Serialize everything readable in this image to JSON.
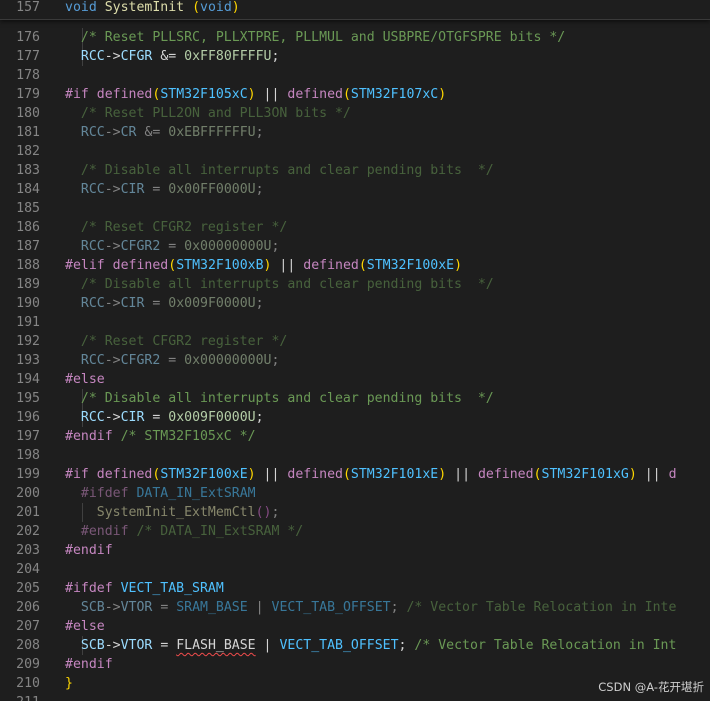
{
  "editor": {
    "sticky": {
      "line_number": "157",
      "tokens": [
        [
          "kw",
          "void"
        ],
        [
          "op",
          " "
        ],
        [
          "fn",
          "SystemInit"
        ],
        [
          "op",
          " "
        ],
        [
          "br1",
          "("
        ],
        [
          "kw",
          "void"
        ],
        [
          "br1",
          ")"
        ]
      ]
    },
    "lines": [
      {
        "n": "176",
        "g": [
          18
        ],
        "t": [
          [
            "op",
            "  "
          ],
          [
            "cm",
            "/* Reset PLLSRC, PLLXTPRE, PLLMUL and USBPRE/OTGFSPRE bits */"
          ]
        ]
      },
      {
        "n": "177",
        "g": [
          18
        ],
        "t": [
          [
            "op",
            "  "
          ],
          [
            "var",
            "RCC"
          ],
          [
            "op",
            "->"
          ],
          [
            "var",
            "CFGR"
          ],
          [
            "op",
            " &= "
          ],
          [
            "num",
            "0xFF80FFFFU"
          ],
          [
            "op",
            ";"
          ]
        ]
      },
      {
        "n": "178",
        "t": []
      },
      {
        "n": "179",
        "t": [
          [
            "pp",
            "#if"
          ],
          [
            "op",
            " "
          ],
          [
            "pp",
            "defined"
          ],
          [
            "br1",
            "("
          ],
          [
            "mac",
            "STM32F105xC"
          ],
          [
            "br1",
            ")"
          ],
          [
            "op",
            " || "
          ],
          [
            "pp",
            "defined"
          ],
          [
            "br1",
            "("
          ],
          [
            "mac",
            "STM32F107xC"
          ],
          [
            "br1",
            ")"
          ]
        ]
      },
      {
        "n": "180",
        "dim": true,
        "t": [
          [
            "op",
            "  "
          ],
          [
            "cm",
            "/* Reset PLL2ON and PLL3ON bits */"
          ]
        ]
      },
      {
        "n": "181",
        "dim": true,
        "t": [
          [
            "op",
            "  "
          ],
          [
            "var",
            "RCC"
          ],
          [
            "op",
            "->"
          ],
          [
            "var",
            "CR"
          ],
          [
            "op",
            " &= "
          ],
          [
            "num",
            "0xEBFFFFFFU"
          ],
          [
            "op",
            ";"
          ]
        ]
      },
      {
        "n": "182",
        "t": []
      },
      {
        "n": "183",
        "dim": true,
        "t": [
          [
            "op",
            "  "
          ],
          [
            "cm",
            "/* Disable all interrupts and clear pending bits  */"
          ]
        ]
      },
      {
        "n": "184",
        "dim": true,
        "t": [
          [
            "op",
            "  "
          ],
          [
            "var",
            "RCC"
          ],
          [
            "op",
            "->"
          ],
          [
            "var",
            "CIR"
          ],
          [
            "op",
            " = "
          ],
          [
            "num",
            "0x00FF0000U"
          ],
          [
            "op",
            ";"
          ]
        ]
      },
      {
        "n": "185",
        "t": []
      },
      {
        "n": "186",
        "dim": true,
        "t": [
          [
            "op",
            "  "
          ],
          [
            "cm",
            "/* Reset CFGR2 register */"
          ]
        ]
      },
      {
        "n": "187",
        "dim": true,
        "t": [
          [
            "op",
            "  "
          ],
          [
            "var",
            "RCC"
          ],
          [
            "op",
            "->"
          ],
          [
            "var",
            "CFGR2"
          ],
          [
            "op",
            " = "
          ],
          [
            "num",
            "0x00000000U"
          ],
          [
            "op",
            ";"
          ]
        ]
      },
      {
        "n": "188",
        "t": [
          [
            "pp",
            "#elif"
          ],
          [
            "op",
            " "
          ],
          [
            "pp",
            "defined"
          ],
          [
            "br1",
            "("
          ],
          [
            "mac",
            "STM32F100xB"
          ],
          [
            "br1",
            ")"
          ],
          [
            "op",
            " || "
          ],
          [
            "pp",
            "defined"
          ],
          [
            "br1",
            "("
          ],
          [
            "mac",
            "STM32F100xE"
          ],
          [
            "br1",
            ")"
          ]
        ]
      },
      {
        "n": "189",
        "dim": true,
        "t": [
          [
            "op",
            "  "
          ],
          [
            "cm",
            "/* Disable all interrupts and clear pending bits  */"
          ]
        ]
      },
      {
        "n": "190",
        "dim": true,
        "t": [
          [
            "op",
            "  "
          ],
          [
            "var",
            "RCC"
          ],
          [
            "op",
            "->"
          ],
          [
            "var",
            "CIR"
          ],
          [
            "op",
            " = "
          ],
          [
            "num",
            "0x009F0000U"
          ],
          [
            "op",
            ";"
          ]
        ]
      },
      {
        "n": "191",
        "t": []
      },
      {
        "n": "192",
        "dim": true,
        "t": [
          [
            "op",
            "  "
          ],
          [
            "cm",
            "/* Reset CFGR2 register */"
          ]
        ]
      },
      {
        "n": "193",
        "dim": true,
        "t": [
          [
            "op",
            "  "
          ],
          [
            "var",
            "RCC"
          ],
          [
            "op",
            "->"
          ],
          [
            "var",
            "CFGR2"
          ],
          [
            "op",
            " = "
          ],
          [
            "num",
            "0x00000000U"
          ],
          [
            "op",
            ";"
          ]
        ]
      },
      {
        "n": "194",
        "t": [
          [
            "pp",
            "#else"
          ]
        ]
      },
      {
        "n": "195",
        "g": [
          18
        ],
        "t": [
          [
            "op",
            "  "
          ],
          [
            "cm",
            "/* Disable all interrupts and clear pending bits  */"
          ]
        ]
      },
      {
        "n": "196",
        "g": [
          18
        ],
        "t": [
          [
            "op",
            "  "
          ],
          [
            "var",
            "RCC"
          ],
          [
            "op",
            "->"
          ],
          [
            "var",
            "CIR"
          ],
          [
            "op",
            " = "
          ],
          [
            "num",
            "0x009F0000U"
          ],
          [
            "op",
            ";"
          ]
        ]
      },
      {
        "n": "197",
        "t": [
          [
            "pp",
            "#endif"
          ],
          [
            "op",
            " "
          ],
          [
            "cm",
            "/* STM32F105xC */"
          ]
        ]
      },
      {
        "n": "198",
        "t": []
      },
      {
        "n": "199",
        "t": [
          [
            "pp",
            "#if"
          ],
          [
            "op",
            " "
          ],
          [
            "pp",
            "defined"
          ],
          [
            "br1",
            "("
          ],
          [
            "mac",
            "STM32F100xE"
          ],
          [
            "br1",
            ")"
          ],
          [
            "op",
            " || "
          ],
          [
            "pp",
            "defined"
          ],
          [
            "br1",
            "("
          ],
          [
            "mac",
            "STM32F101xE"
          ],
          [
            "br1",
            ")"
          ],
          [
            "op",
            " || "
          ],
          [
            "pp",
            "defined"
          ],
          [
            "br1",
            "("
          ],
          [
            "mac",
            "STM32F101xG"
          ],
          [
            "br1",
            ")"
          ],
          [
            "op",
            " || "
          ],
          [
            "pp",
            "d"
          ]
        ]
      },
      {
        "n": "200",
        "dim": true,
        "t": [
          [
            "op",
            "  "
          ],
          [
            "pp",
            "#ifdef"
          ],
          [
            "op",
            " "
          ],
          [
            "mac",
            "DATA_IN_ExtSRAM"
          ]
        ]
      },
      {
        "n": "201",
        "dim": true,
        "g": [
          18
        ],
        "t": [
          [
            "op",
            "    "
          ],
          [
            "fn",
            "SystemInit_ExtMemCtl"
          ],
          [
            "br2",
            "()"
          ],
          [
            "op",
            ";"
          ]
        ]
      },
      {
        "n": "202",
        "dim": true,
        "t": [
          [
            "op",
            "  "
          ],
          [
            "pp",
            "#endif"
          ],
          [
            "op",
            " "
          ],
          [
            "cm",
            "/* DATA_IN_ExtSRAM */"
          ]
        ]
      },
      {
        "n": "203",
        "t": [
          [
            "pp",
            "#endif"
          ]
        ]
      },
      {
        "n": "204",
        "t": []
      },
      {
        "n": "205",
        "t": [
          [
            "pp",
            "#ifdef"
          ],
          [
            "op",
            " "
          ],
          [
            "mac",
            "VECT_TAB_SRAM"
          ]
        ]
      },
      {
        "n": "206",
        "dim": true,
        "t": [
          [
            "op",
            "  "
          ],
          [
            "var",
            "SCB"
          ],
          [
            "op",
            "->"
          ],
          [
            "var",
            "VTOR"
          ],
          [
            "op",
            " = "
          ],
          [
            "mac",
            "SRAM_BASE"
          ],
          [
            "op",
            " | "
          ],
          [
            "mac",
            "VECT_TAB_OFFSET"
          ],
          [
            "op",
            "; "
          ],
          [
            "cm",
            "/* Vector Table Relocation in Inte"
          ]
        ]
      },
      {
        "n": "207",
        "t": [
          [
            "pp",
            "#else"
          ]
        ]
      },
      {
        "n": "208",
        "g": [
          18
        ],
        "t": [
          [
            "op",
            "  "
          ],
          [
            "var",
            "SCB"
          ],
          [
            "op",
            "->"
          ],
          [
            "var",
            "VTOR"
          ],
          [
            "op",
            " = "
          ],
          [
            "squig",
            "FLASH_BASE"
          ],
          [
            "op",
            " | "
          ],
          [
            "mac",
            "VECT_TAB_OFFSET"
          ],
          [
            "op",
            "; "
          ],
          [
            "cm",
            "/* Vector Table Relocation in Int"
          ]
        ]
      },
      {
        "n": "209",
        "t": [
          [
            "pp",
            "#endif"
          ]
        ]
      },
      {
        "n": "210",
        "t": [
          [
            "br1",
            "}"
          ]
        ]
      },
      {
        "n": "211",
        "t": []
      }
    ]
  },
  "watermark": "CSDN @A-花开堪折"
}
